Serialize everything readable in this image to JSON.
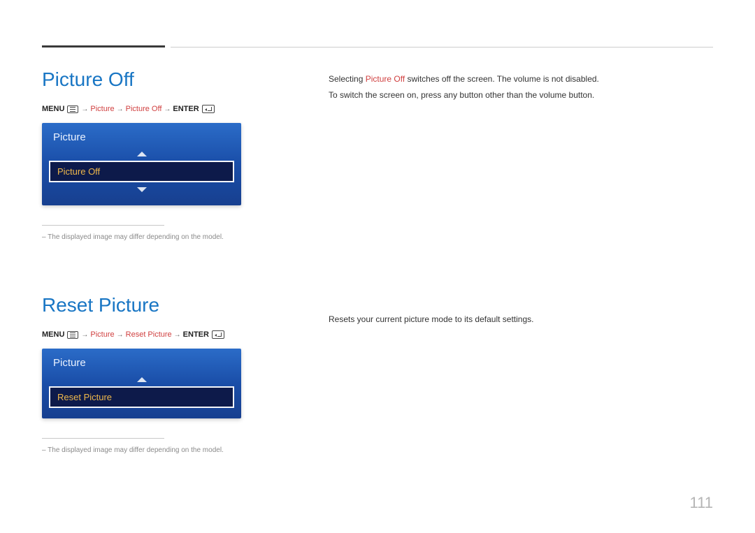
{
  "page_number": "111",
  "section1": {
    "title": "Picture Off",
    "menu_path": {
      "menu": "MENU",
      "step1": "Picture",
      "step2": "Picture Off",
      "enter": "ENTER"
    },
    "osd": {
      "title": "Picture",
      "selected": "Picture Off"
    },
    "footnote": "The displayed image may differ depending on the model.",
    "description": {
      "line1_pre": "Selecting ",
      "line1_accent": "Picture Off",
      "line1_post": " switches off the screen. The volume is not disabled.",
      "line2": "To switch the screen on, press any button other than the volume button."
    }
  },
  "section2": {
    "title": "Reset Picture",
    "menu_path": {
      "menu": "MENU",
      "step1": "Picture",
      "step2": "Reset Picture",
      "enter": "ENTER"
    },
    "osd": {
      "title": "Picture",
      "selected": "Reset Picture"
    },
    "footnote": "The displayed image may differ depending on the model.",
    "description": {
      "text": "Resets your current picture mode to its default settings."
    }
  }
}
